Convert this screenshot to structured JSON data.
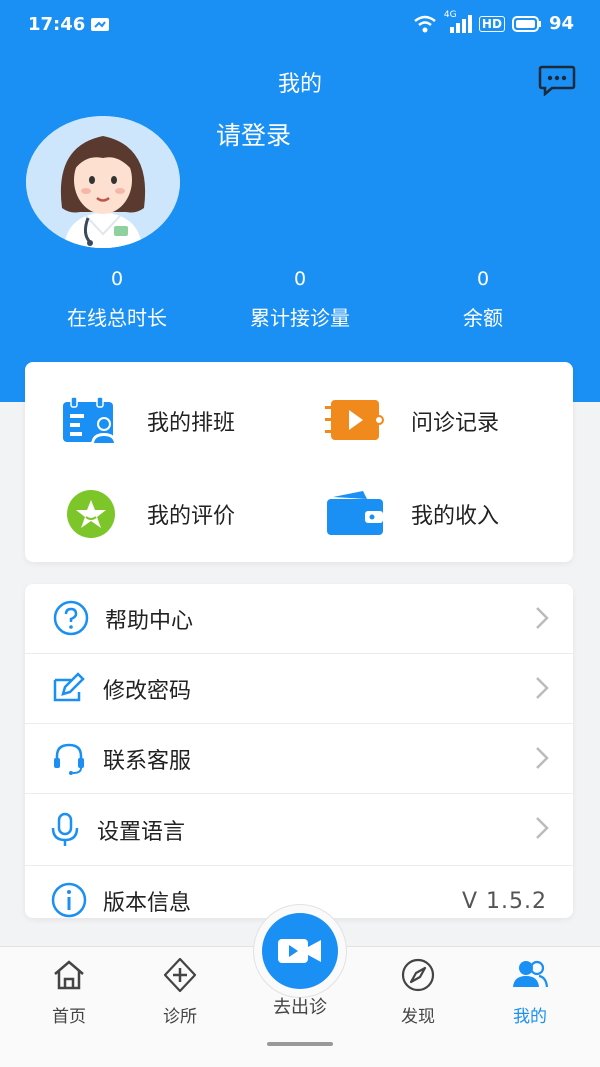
{
  "status_bar": {
    "time": "17:46",
    "network": "4G",
    "hd": "HD",
    "battery": "94"
  },
  "header": {
    "title": "我的",
    "login_prompt": "请登录"
  },
  "stats": [
    {
      "value": "0",
      "label": "在线总时长"
    },
    {
      "value": "0",
      "label": "累计接诊量"
    },
    {
      "value": "0",
      "label": "余额"
    }
  ],
  "features": [
    {
      "label": "我的排班",
      "icon": "schedule-icon"
    },
    {
      "label": "问诊记录",
      "icon": "video-record-icon"
    },
    {
      "label": "我的评价",
      "icon": "star-icon"
    },
    {
      "label": "我的收入",
      "icon": "wallet-icon"
    }
  ],
  "menu": [
    {
      "label": "帮助中心",
      "icon": "help-icon"
    },
    {
      "label": "修改密码",
      "icon": "edit-password-icon"
    },
    {
      "label": "联系客服",
      "icon": "headset-icon"
    },
    {
      "label": "设置语言",
      "icon": "microphone-icon"
    },
    {
      "label": "版本信息",
      "icon": "info-icon",
      "value": "V 1.5.2"
    }
  ],
  "tabs": [
    {
      "label": "首页",
      "icon": "home-icon"
    },
    {
      "label": "诊所",
      "icon": "clinic-plus-icon"
    },
    {
      "label": "去出诊",
      "icon": "video-camera-icon"
    },
    {
      "label": "发现",
      "icon": "compass-icon"
    },
    {
      "label": "我的",
      "icon": "user-group-icon",
      "active": true
    }
  ],
  "colors": {
    "primary": "#1a90f4",
    "orange": "#f08a1c",
    "green": "#7cc629",
    "text": "#222222"
  }
}
